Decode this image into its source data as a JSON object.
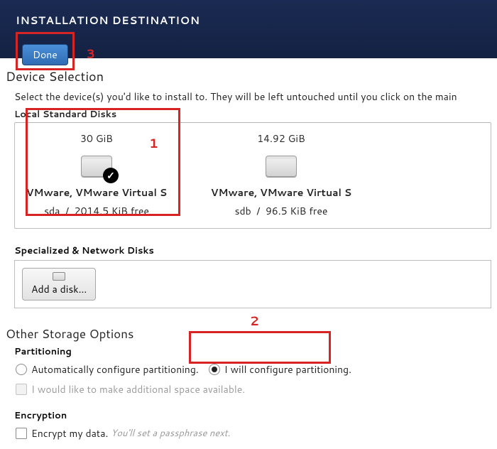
{
  "header": {
    "title": "INSTALLATION DESTINATION",
    "done_label": "Done"
  },
  "annotations": {
    "step1": "1",
    "step2": "2",
    "step3": "3"
  },
  "device_selection": {
    "title": "Device Selection",
    "subtitle": "Select the device(s) you'd like to install to.  They will be left untouched until you click on the main",
    "local_label": "Local Standard Disks",
    "disks": [
      {
        "size": "30 GiB",
        "name": "VMware, VMware Virtual S",
        "dev": "sda",
        "free": "2014.5 KiB free",
        "selected": true
      },
      {
        "size": "14.92 GiB",
        "name": "VMware, VMware Virtual S",
        "dev": "sdb",
        "free": "96.5 KiB free",
        "selected": false
      }
    ],
    "specialized_label": "Specialized & Network Disks",
    "add_disk_label": "Add a disk..."
  },
  "other": {
    "title": "Other Storage Options",
    "partitioning_label": "Partitioning",
    "auto_label": "Automatically configure partitioning.",
    "manual_label": "I will configure partitioning.",
    "additional_space_label": "I would like to make additional space available.",
    "encryption_label": "Encryption",
    "encrypt_label": "Encrypt my data.",
    "encrypt_hint": "You'll set a passphrase next."
  }
}
